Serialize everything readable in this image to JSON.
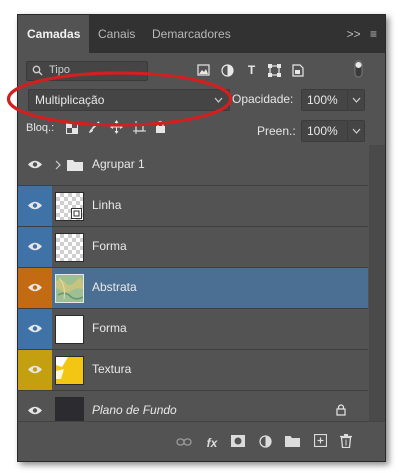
{
  "tabs": [
    {
      "label": "Camadas",
      "active": true
    },
    {
      "label": "Canais",
      "active": false
    },
    {
      "label": "Demarcadores",
      "active": false
    }
  ],
  "tab_menu_icons": [
    ">>",
    "≡"
  ],
  "search": {
    "placeholder": "Tipo"
  },
  "filter_icons": [
    "image-filter-icon",
    "adjustment-filter-icon",
    "type-filter-icon",
    "shape-filter-icon",
    "smartobject-filter-icon",
    "filter-toggle-icon"
  ],
  "blend_mode": {
    "value": "Multiplicação"
  },
  "opacity": {
    "label": "Opacidade:",
    "value": "100%"
  },
  "lock": {
    "label": "Bloq.:"
  },
  "fill": {
    "label": "Preen.:",
    "value": "100%"
  },
  "layers": [
    {
      "name": "Agrupar 1",
      "type": "group",
      "eye_color": "#535353",
      "selected": false
    },
    {
      "name": "Linha",
      "type": "layer",
      "eye_color": "#3f73a8",
      "selected": false
    },
    {
      "name": "Forma",
      "type": "layer",
      "eye_color": "#3f73a8",
      "selected": false
    },
    {
      "name": "Abstrata",
      "type": "layer",
      "eye_color": "#c36b13",
      "selected": true
    },
    {
      "name": "Forma",
      "type": "layer",
      "eye_color": "#3f73a8",
      "selected": false
    },
    {
      "name": "Textura",
      "type": "layer",
      "eye_color": "#c4a011",
      "selected": false
    },
    {
      "name": "Plano de Fundo",
      "type": "background",
      "eye_color": "#535353",
      "selected": false
    }
  ],
  "bottom_icons": [
    "link-icon",
    "fx-icon",
    "mask-icon",
    "adjustment-icon",
    "folder-icon",
    "new-layer-icon",
    "trash-icon"
  ],
  "colors": {
    "highlight": "#d21f1f",
    "selected_row": "#4a6f92",
    "panel": "#535353"
  }
}
